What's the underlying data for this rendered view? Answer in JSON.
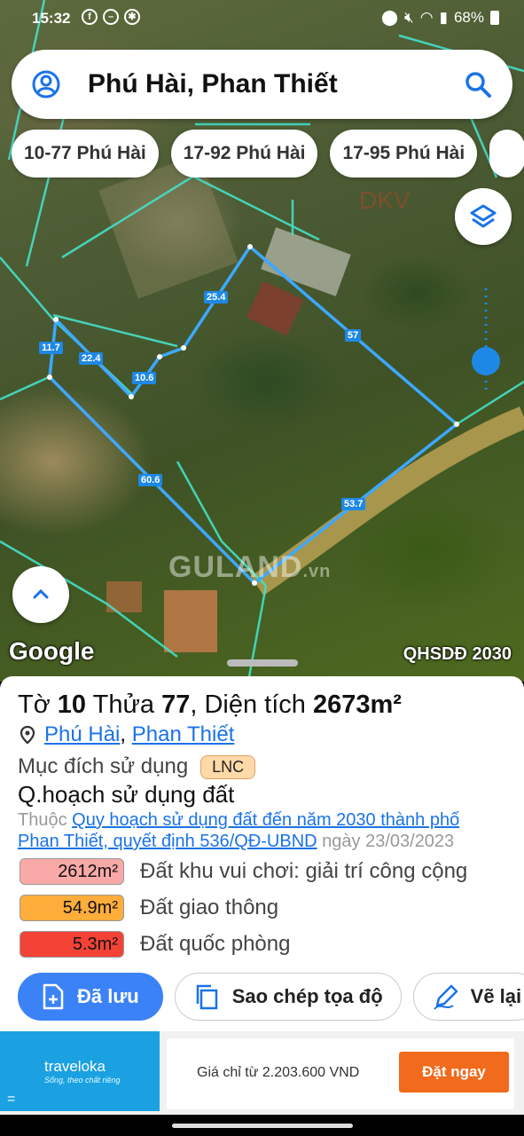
{
  "status_bar": {
    "time": "15:32",
    "battery": "68%",
    "left_icons": [
      "facebook-icon",
      "do-not-disturb-icon",
      "accessibility-icon"
    ],
    "right_icons": [
      "location-icon",
      "mute-icon",
      "wifi-icon",
      "signal-icon",
      "battery-icon"
    ]
  },
  "search": {
    "query": "Phú Hài, Phan Thiết"
  },
  "chips": [
    {
      "label": "10-77 Phú Hài"
    },
    {
      "label": "17-92 Phú Hài"
    },
    {
      "label": "17-95 Phú Hài"
    }
  ],
  "map": {
    "dimension_labels": [
      "25.4",
      "57",
      "11.7",
      "22.4",
      "10.6",
      "60.6",
      "53.7"
    ],
    "watermark": "GULAND",
    "watermark_suffix": ".vn",
    "faded_text": "DKV",
    "provider_logo": "Google",
    "plan_layer": "QHSDĐ 2030",
    "parcel_outline_color": "#3da8ff",
    "boundary_color": "#44e0c8"
  },
  "parcel": {
    "sheet_prefix": "Tờ",
    "sheet_no": "10",
    "plot_prefix": "Thửa",
    "plot_no": "77",
    "area_prefix": ", Diện tích",
    "area_value": "2673m²",
    "ward": "Phú Hài",
    "separator": ",",
    "city": "Phan Thiết",
    "usage_label": "Mục đích sử dụng",
    "usage_code": "LNC",
    "plan_heading": "Q.hoạch sử dụng đất",
    "plan_prefix": "Thuộc",
    "plan_link": "Quy hoạch sử dụng đất đến năm 2030 thành phố Phan Thiết, quyết định 536/QĐ-UBND",
    "plan_date": "ngày 23/03/2023",
    "areas": [
      {
        "value": "2612m²",
        "label": "Đất khu vui chơi: giải trí công cộng",
        "color": "#f9a8a8"
      },
      {
        "value": "54.9m²",
        "label": "Đất giao thông",
        "color": "#ffad3b"
      },
      {
        "value": "5.3m²",
        "label": "Đất quốc phòng",
        "color": "#f44336"
      }
    ]
  },
  "actions": {
    "saved": "Đã lưu",
    "copy_coords": "Sao chép tọa độ",
    "redraw": "Vẽ lại"
  },
  "ad": {
    "brand": "traveloka",
    "tagline": "Sống, theo chất riêng",
    "price_text": "Giá chỉ từ 2.203.600 VND",
    "cta": "Đặt ngay",
    "menu_glyph": "="
  }
}
